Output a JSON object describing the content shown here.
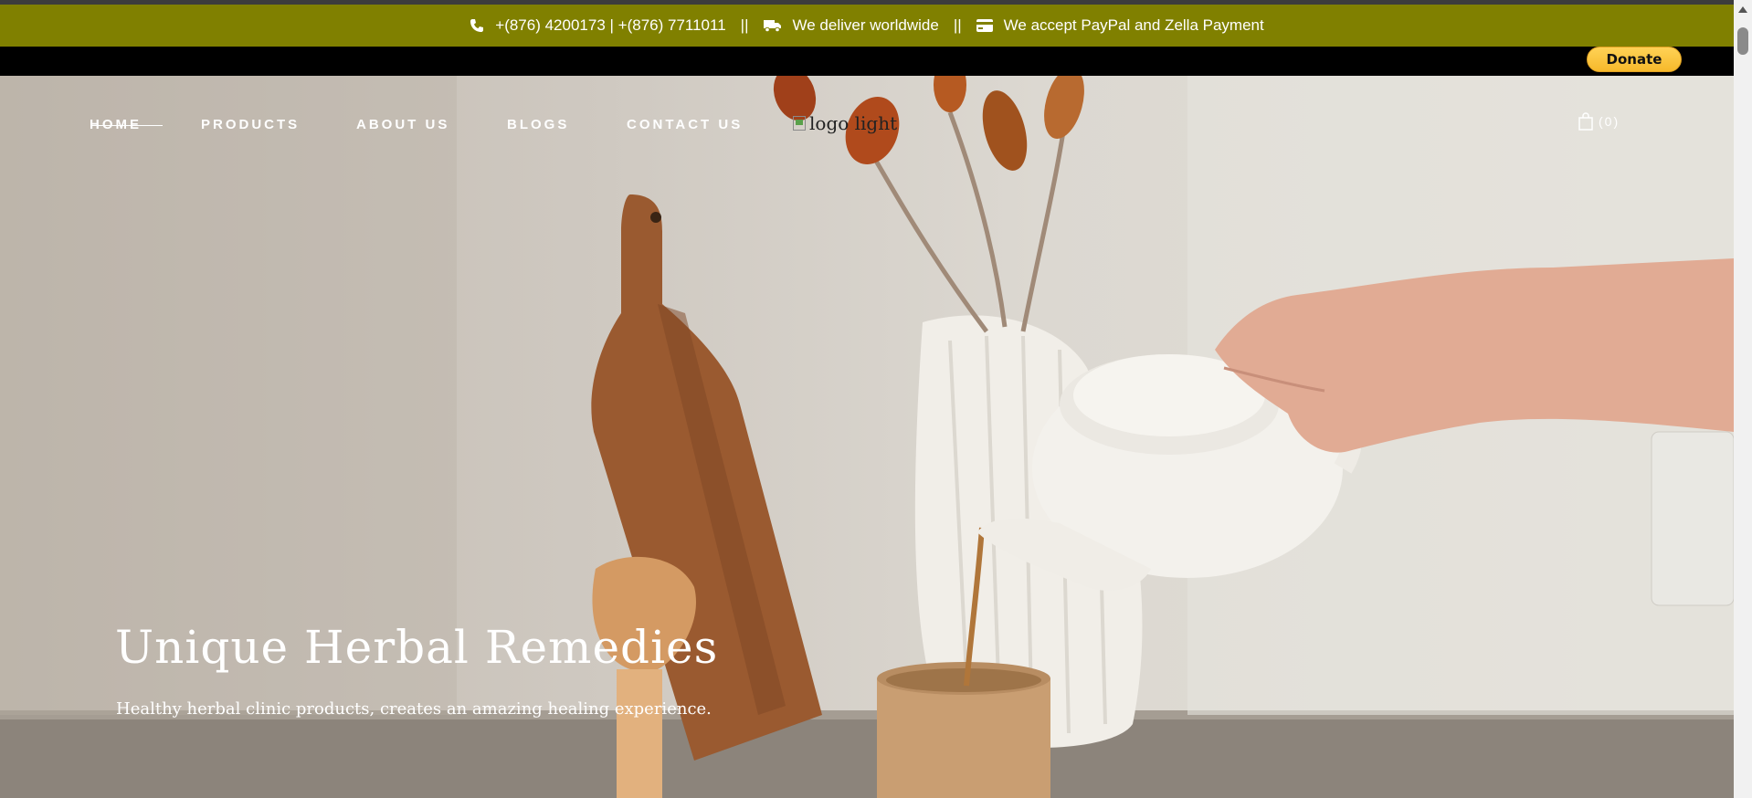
{
  "infobar": {
    "phone": "+(876) 4200173 | +(876) 7711011",
    "separator": "||",
    "delivery": "We deliver worldwide",
    "payment": "We accept PayPal and Zella Payment",
    "color": "#808000"
  },
  "donate": {
    "label": "Donate"
  },
  "nav": {
    "items": [
      {
        "label": "HOME"
      },
      {
        "label": "PRODUCTS"
      },
      {
        "label": "ABOUT US"
      },
      {
        "label": "BLOGS"
      },
      {
        "label": "CONTACT US"
      }
    ]
  },
  "logo": {
    "alt_text": "logo light"
  },
  "cart": {
    "count": "(0)",
    "icon": "shopping-bag-icon"
  },
  "hero": {
    "title": "Unique Herbal Remedies",
    "subtitle": "Healthy herbal clinic products, creates an amazing healing experience."
  }
}
